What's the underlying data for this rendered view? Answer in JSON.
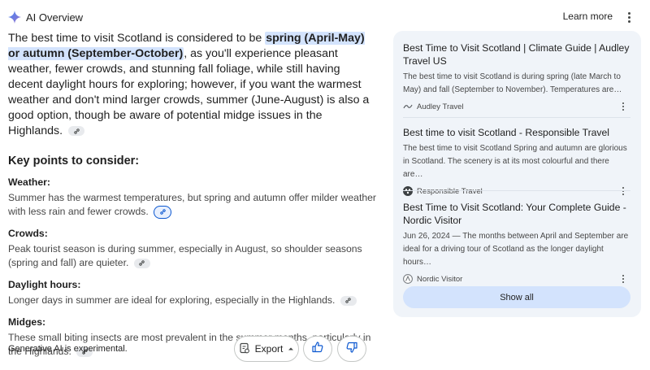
{
  "header": {
    "title": "AI Overview",
    "learn_more": "Learn more"
  },
  "summary": {
    "part1": "The best time to visit Scotland is considered to be ",
    "highlight": "spring (April-May) or autumn (September-October)",
    "part2": ", as you'll experience pleasant weather, fewer crowds, and stunning fall foliage, while still having decent daylight hours for exploring; however, if you want the warmest weather and don't mind larger crowds, summer (June-August) is also a good option, though be aware of potential midge issues in the Highlands."
  },
  "key_points": {
    "title": "Key points to consider:",
    "items": [
      {
        "heading": "Weather:",
        "text": "Summer has the warmest temperatures, but spring and autumn offer milder weather with less rain and fewer crowds."
      },
      {
        "heading": "Crowds:",
        "text": "Peak tourist season is during summer, especially in August, so shoulder seasons (spring and fall) are quieter."
      },
      {
        "heading": "Daylight hours:",
        "text": "Longer days in summer are ideal for exploring, especially in the Highlands."
      },
      {
        "heading": "Midges:",
        "text": "These small biting insects are most prevalent in the summer months, particularly in the Highlands."
      }
    ]
  },
  "footer": {
    "disclaimer": "Generative AI is experimental.",
    "export_label": "Export"
  },
  "sources": {
    "cards": [
      {
        "title": "Best Time to Visit Scotland | Climate Guide | Audley Travel US",
        "snippet": "The best time to visit Scotland is during spring (late March to May) and fall (September to November). Temperatures are…",
        "source": "Audley Travel"
      },
      {
        "title": "Best time to visit Scotland - Responsible Travel",
        "snippet": "The best time to visit Scotland Spring and autumn are glorious in Scotland. The scenery is at its most colourful and there are…",
        "source": "Responsible Travel"
      },
      {
        "title": "Best Time to Visit Scotland: Your Complete Guide - Nordic Visitor",
        "snippet": "Jun 26, 2024 — The months between April and September are ideal for a driving tour of Scotland as the longer daylight hours…",
        "source": "Nordic Visitor"
      }
    ],
    "show_all": "Show all"
  },
  "colors": {
    "highlight": "#d3e3fd",
    "panel_bg": "#f0f4f9",
    "accent": "#0b57d0"
  }
}
